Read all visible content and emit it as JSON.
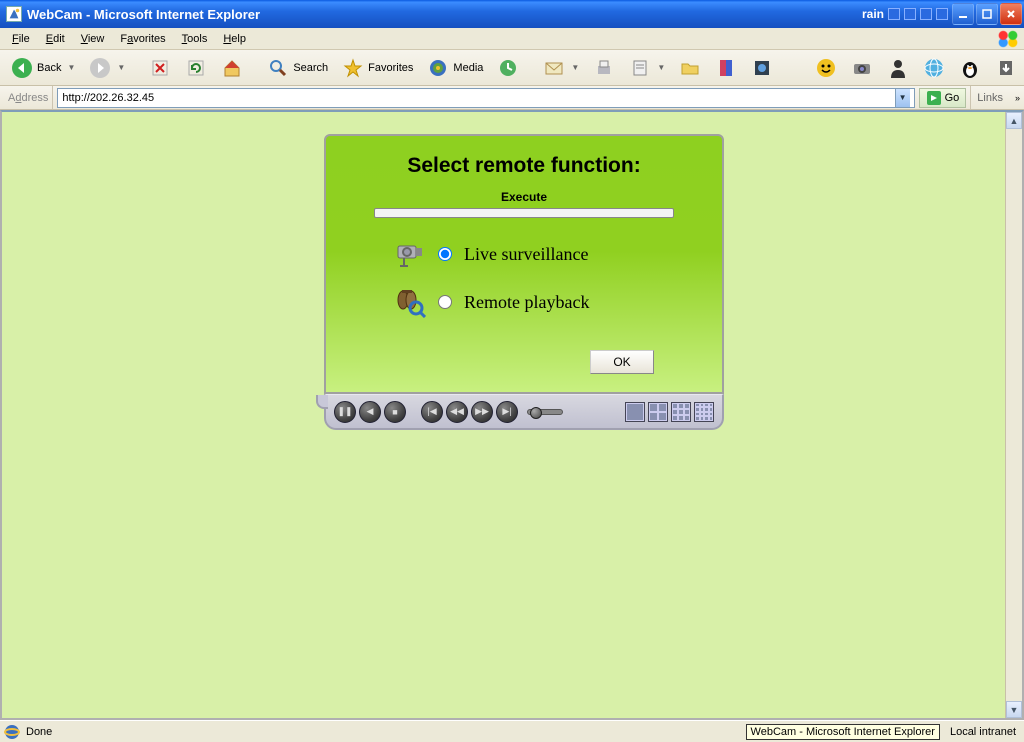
{
  "window": {
    "title": "WebCam - Microsoft Internet Explorer",
    "tray_label": "rain"
  },
  "menus": {
    "file": "File",
    "edit": "Edit",
    "view": "View",
    "favorites": "Favorites",
    "tools": "Tools",
    "help": "Help"
  },
  "toolbar": {
    "back": "Back",
    "search": "Search",
    "favorites": "Favorites",
    "media": "Media"
  },
  "address": {
    "label": "Address",
    "url": "http://202.26.32.45",
    "go": "Go",
    "links": "Links"
  },
  "panel": {
    "title": "Select remote function:",
    "execute": "Execute",
    "option_live": "Live surveillance",
    "option_playback": "Remote playback",
    "ok": "OK",
    "selected": "live"
  },
  "status": {
    "text": "Done",
    "tooltip": "WebCam - Microsoft Internet Explorer",
    "zone": "Local intranet"
  }
}
